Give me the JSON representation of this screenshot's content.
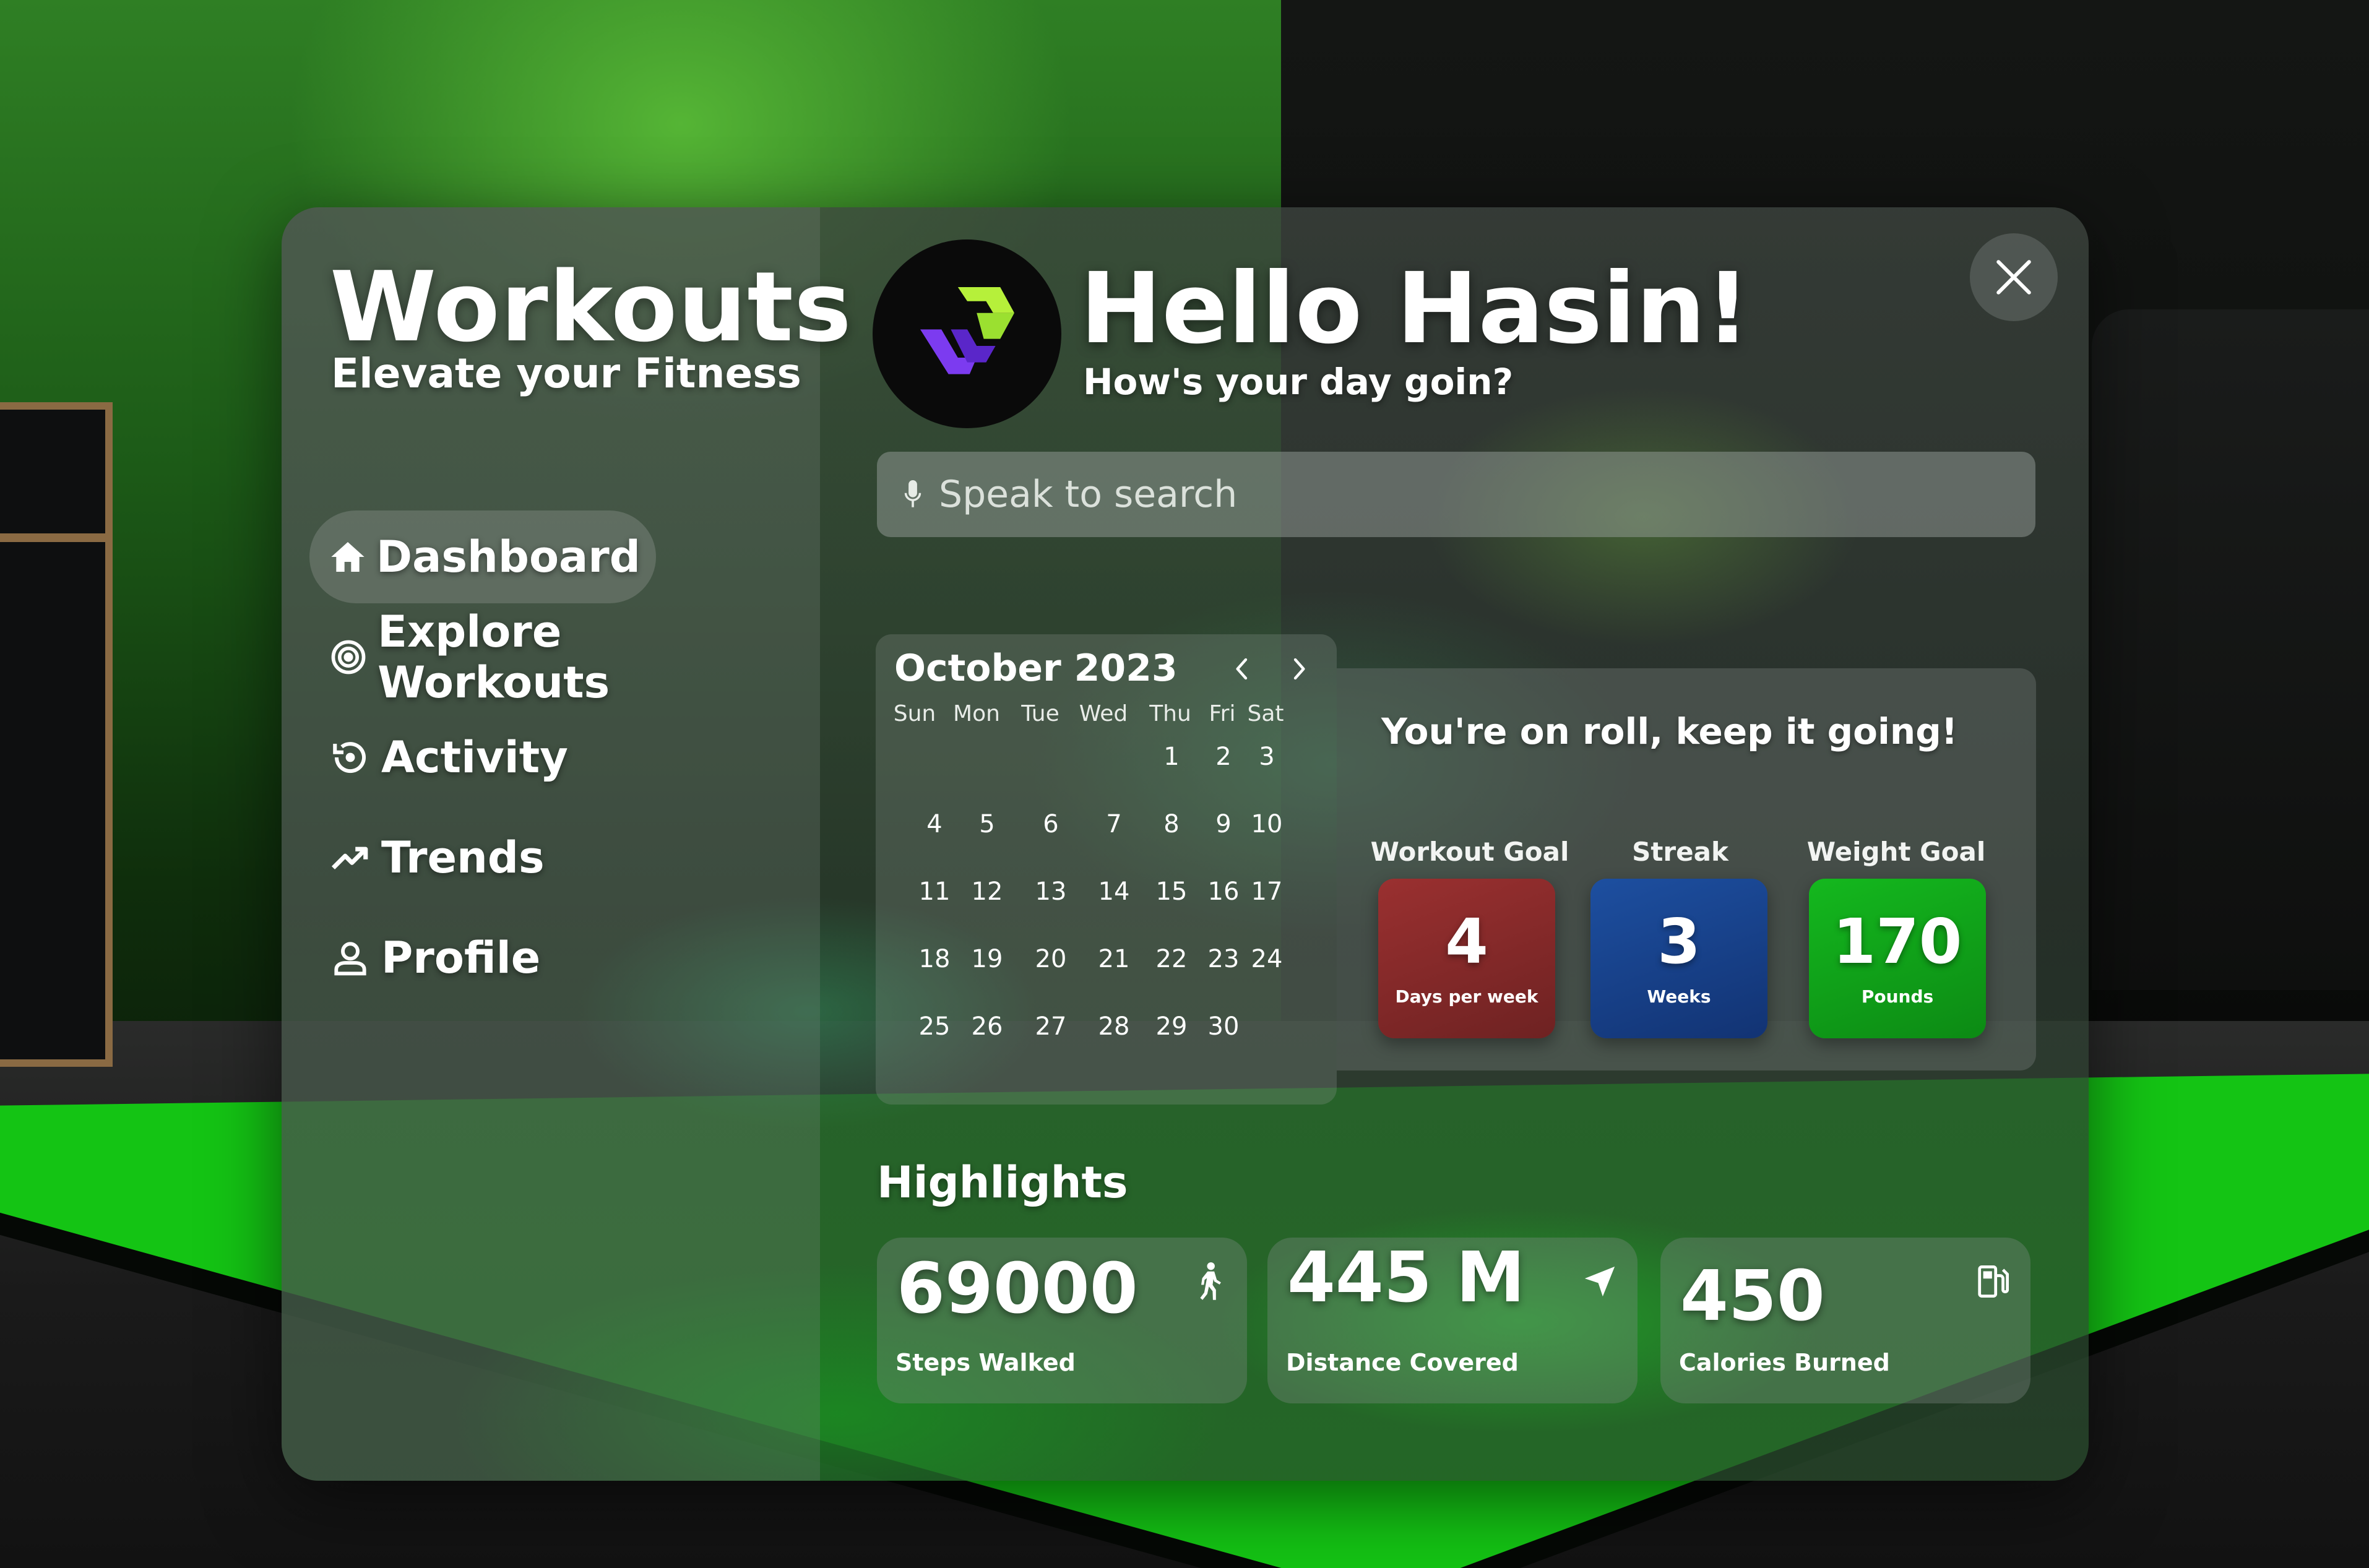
{
  "app": {
    "title": "Workouts",
    "subtitle": "Elevate your Fitness"
  },
  "nav": [
    {
      "label": "Dashboard",
      "icon": "home-icon",
      "active": true
    },
    {
      "label": "Explore Workouts",
      "icon": "target-icon",
      "active": false
    },
    {
      "label": "Activity",
      "icon": "history-icon",
      "active": false
    },
    {
      "label": "Trends",
      "icon": "trend-up-icon",
      "active": false
    },
    {
      "label": "Profile",
      "icon": "person-icon",
      "active": false
    }
  ],
  "header": {
    "greeting": "Hello Hasin!",
    "subgreeting": "How's your day goin?"
  },
  "search": {
    "placeholder": "Speak to search"
  },
  "calendar": {
    "month": "October 2023",
    "weekdays": [
      "Sun",
      "Mon",
      "Tue",
      "Wed",
      "Thu",
      "Fri",
      "Sat"
    ],
    "weeks": [
      [
        "",
        "",
        "",
        "",
        "1",
        "2",
        "3"
      ],
      [
        "4",
        "5",
        "6",
        "7",
        "8",
        "9",
        "10"
      ],
      [
        "11",
        "12",
        "13",
        "14",
        "15",
        "16",
        "17"
      ],
      [
        "18",
        "19",
        "20",
        "21",
        "22",
        "23",
        "24"
      ],
      [
        "25",
        "26",
        "27",
        "28",
        "29",
        "30",
        ""
      ]
    ]
  },
  "stats": {
    "title": "You're on roll, keep it going!",
    "items": [
      {
        "label": "Workout Goal",
        "value": "4",
        "unit": "Days per week",
        "color": "#8a2b2b"
      },
      {
        "label": "Streak",
        "value": "3",
        "unit": "Weeks",
        "color": "#163f86"
      },
      {
        "label": "Weight Goal",
        "value": "170",
        "unit": "Pounds",
        "color": "#12a11c"
      }
    ]
  },
  "highlights": {
    "title": "Highlights",
    "items": [
      {
        "value": "69000",
        "label": "Steps Walked",
        "icon": "walking-person-icon"
      },
      {
        "value": "445 M",
        "label": "Distance Covered",
        "icon": "navigation-arrow-icon"
      },
      {
        "value": "450",
        "label": "Calories Burned",
        "icon": "fuel-pump-icon"
      }
    ]
  }
}
